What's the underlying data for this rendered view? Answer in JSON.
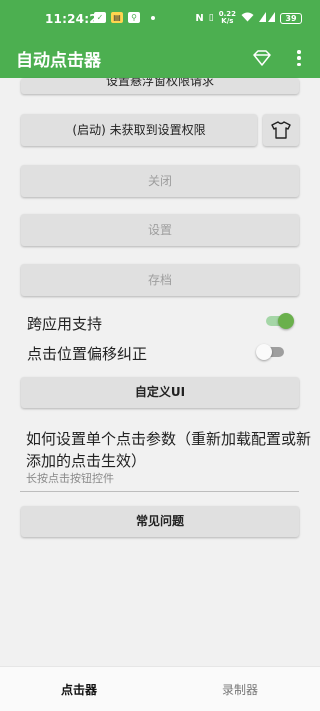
{
  "status_bar": {
    "time": "11:24:28",
    "speed_value": "0.22",
    "speed_unit": "K/s",
    "battery": "39"
  },
  "app_bar": {
    "title": "自动点击器"
  },
  "buttons": {
    "overlay_permission": "设置悬浮窗权限请求",
    "start": "(启动) 未获取到设置权限",
    "close": "关闭",
    "settings": "设置",
    "save": "存档",
    "custom_ui": "自定义UI",
    "faq": "常见问题"
  },
  "toggles": {
    "cross_app": {
      "label": "跨应用支持",
      "on": true
    },
    "offset_fix": {
      "label": "点击位置偏移纠正",
      "on": false
    }
  },
  "info": {
    "title": "如何设置单个点击参数（重新加载配置或新添加的点击生效）",
    "subtitle": "长按点击按钮控件"
  },
  "bottom_nav": {
    "tabs": [
      "点击器",
      "录制器"
    ],
    "active_index": 0
  },
  "colors": {
    "primary": "#4caf50",
    "switch_on_thumb": "#6ab04c",
    "switch_on_track": "#a5d6a7",
    "switch_off_thumb": "#fafafa",
    "switch_off_track": "#9e9e9e"
  }
}
